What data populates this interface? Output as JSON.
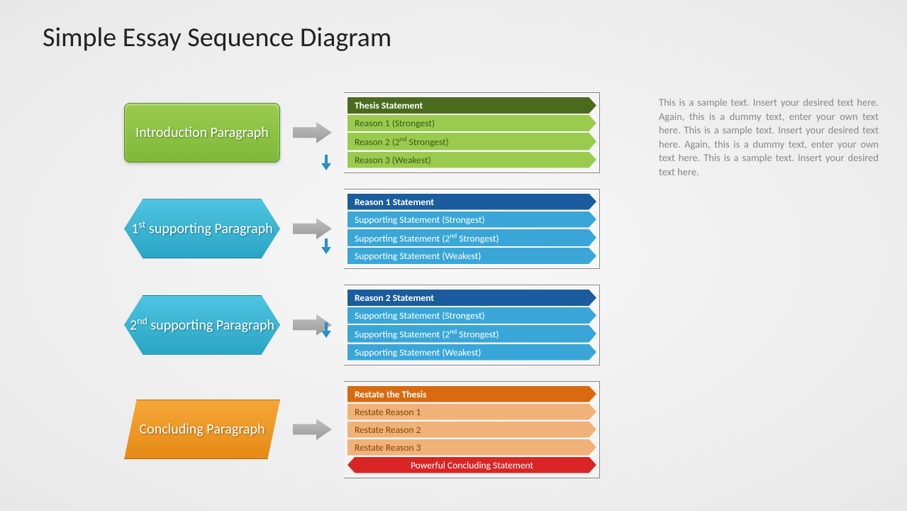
{
  "title": "Simple Essay Sequence Diagram",
  "shapes": {
    "intro": "Introduction Paragraph",
    "sup1_pre": "1",
    "sup1_ord": "st",
    "sup1_post": " supporting Paragraph",
    "sup2_pre": "2",
    "sup2_ord": "nd",
    "sup2_post": " supporting Paragraph",
    "conc": "Concluding Paragraph"
  },
  "box1": {
    "head": "Thesis Statement",
    "r1": "Reason 1 (Strongest)",
    "r2a": "Reason 2 (2",
    "r2b": "nd",
    "r2c": " Strongest)",
    "r3": "Reason 3 (Weakest)"
  },
  "box2": {
    "head": "Reason 1 Statement",
    "r1": "Supporting Statement (Strongest)",
    "r2a": "Supporting Statement (2",
    "r2b": "nd",
    "r2c": " Strongest)",
    "r3": "Supporting Statement (Weakest)"
  },
  "box3": {
    "head": "Reason 2 Statement",
    "r1": "Supporting Statement (Strongest)",
    "r2a": "Supporting Statement (2",
    "r2b": "nd",
    "r2c": " Strongest)",
    "r3": "Supporting Statement (Weakest)"
  },
  "box4": {
    "head": "Restate the Thesis",
    "r1": "Restate Reason 1",
    "r2": "Restate Reason 2",
    "r3": "Restate Reason 3",
    "final": "Powerful Concluding Statement"
  },
  "sidebar": "This is a sample text. Insert your desired text here. Again, this is a dummy text, enter your own text here. This is a sample text. Insert your desired text here. Again, this is a dummy text, enter your own text here. This is a sample text. Insert your desired text here."
}
